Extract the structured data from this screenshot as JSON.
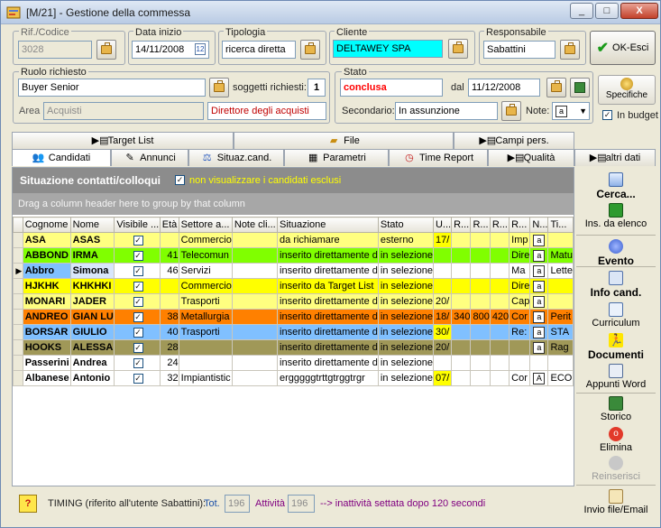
{
  "window": {
    "title": "[M/21] - Gestione della commessa",
    "controls": {
      "minimize": "_",
      "maximize": "□",
      "close": "X"
    }
  },
  "header": {
    "rif_label": "Rif./Codice",
    "rif_value": "3028",
    "data_inizio_label": "Data inizio",
    "data_inizio_value": "14/11/2008",
    "tipologia_label": "Tipologia",
    "tipologia_value": "ricerca diretta",
    "cliente_label": "Cliente",
    "cliente_value": "DELTAWEY SPA",
    "responsabile_label": "Responsabile",
    "responsabile_value": "Sabattini",
    "ok_label": "OK-Esci",
    "ruolo_label": "Ruolo richiesto",
    "ruolo_value": "Buyer Senior",
    "soggetti_label": "soggetti richiesti:",
    "soggetti_value": "1",
    "area_label": "Area",
    "area_value": "Acquisti",
    "direttore_value": "Direttore degli acquisti",
    "stato_label": "Stato",
    "stato_value": "conclusa",
    "dal_label": "dal",
    "dal_value": "11/12/2008",
    "secondario_label": "Secondario:",
    "secondario_value": "In assunzione",
    "note_label": "Note:",
    "specifiche_label": "Specifiche",
    "in_budget_label": "In budget",
    "in_budget_checked": "✓"
  },
  "tabs_top": [
    {
      "label": "Target List",
      "icon": "target-list-icon"
    },
    {
      "label": "File",
      "icon": "folder-icon"
    },
    {
      "label": "Campi pers.",
      "icon": "custom-fields-icon"
    }
  ],
  "tabs_bottom": [
    {
      "label": "Candidati",
      "icon": "people-icon"
    },
    {
      "label": "Annunci",
      "icon": "ads-icon"
    },
    {
      "label": "Situaz.cand.",
      "icon": "status-icon"
    },
    {
      "label": "Parametri",
      "icon": "params-icon"
    },
    {
      "label": "Time Report",
      "icon": "clock-icon"
    },
    {
      "label": "Qualità",
      "icon": "quality-icon"
    },
    {
      "label": "altri dati",
      "icon": "other-data-icon"
    }
  ],
  "section": {
    "title": "Situazione contatti/colloqui",
    "filter_label": "non visualizzare i candidati esclusi",
    "filter_checked": "✓",
    "group_hint": "Drag a column header here to group by that column"
  },
  "grid": {
    "columns": [
      "Cognome",
      "Nome",
      "Visibile ...",
      "Età",
      "Settore a...",
      "Note cli...",
      "Situazione",
      "Stato",
      "U...",
      "R...",
      "R...",
      "R...",
      "R...",
      "N...",
      "Ti..."
    ],
    "rows": [
      {
        "bg": "#ffff80",
        "cells": [
          "ASA",
          "ASAS",
          "✓",
          "",
          "Commercio",
          "",
          "da richiamare",
          "esterno",
          "17/",
          "",
          "",
          "",
          "Imp",
          "a",
          ""
        ],
        "bold": true
      },
      {
        "bg": "#80ff00",
        "cells": [
          "ABBOND",
          "IRMA",
          "✓",
          "41",
          "Telecomun",
          "",
          "inserito direttamente d",
          "in selezione",
          "",
          "",
          "",
          "",
          "Dire",
          "a",
          "Matu"
        ],
        "bold": true
      },
      {
        "bg": "#ffffff",
        "cells": [
          "Abbro",
          "Simona",
          "✓",
          "46",
          "Servizi",
          "",
          "inserito direttamente d",
          "in selezione",
          "",
          "",
          "",
          "",
          "Ma",
          "a",
          "Lette"
        ],
        "bold": true,
        "current": true
      },
      {
        "bg": "#ffff00",
        "cells": [
          "HJKHK",
          "KHKHKI",
          "✓",
          "",
          "Commercio",
          "",
          "inserito da Target List",
          "in selezione",
          "",
          "",
          "",
          "",
          "Dire",
          "a",
          ""
        ],
        "bold": true
      },
      {
        "bg": "#ffff80",
        "cells": [
          "MONARI",
          "JADER",
          "✓",
          "",
          "Trasporti",
          "",
          "inserito direttamente d",
          "in selezione",
          "20/",
          "",
          "",
          "",
          "Cap",
          "a",
          ""
        ],
        "bold": true
      },
      {
        "bg": "#ff8000",
        "cells": [
          "ANDREO",
          "GIAN LU",
          "✓",
          "38",
          "Metallurgia",
          "",
          "inserito direttamente d",
          "in selezione",
          "18/",
          "340",
          "800",
          "420",
          "Cor",
          "a",
          "Perit"
        ],
        "bold": true
      },
      {
        "bg": "#80c0ff",
        "cells": [
          "BORSAR",
          "GIULIO",
          "✓",
          "40",
          "Trasporti",
          "",
          "inserito direttamente d",
          "in selezione",
          "30/",
          "",
          "",
          "",
          "Re:",
          "a",
          "STA"
        ],
        "bold": true
      },
      {
        "bg": "#a09858",
        "cells": [
          "HOOKS",
          "ALESSA",
          "✓",
          "28",
          "",
          "",
          "inserito direttamente d",
          "in selezione",
          "20/",
          "",
          "",
          "",
          "",
          "a",
          "Rag"
        ],
        "bold": true
      },
      {
        "bg": "#ffffff",
        "cells": [
          "Passerini",
          "Andrea",
          "✓",
          "24",
          "",
          "",
          "inserito direttamente d",
          "in selezione",
          "",
          "",
          "",
          "",
          "",
          "",
          ""
        ],
        "bold": true
      },
      {
        "bg": "#ffffff",
        "cells": [
          "Albanese",
          "Antonio",
          "✓",
          "32",
          "Impiantistic",
          "",
          "ergggggtrttgtrggtrgr",
          "in selezione",
          "07/",
          "",
          "",
          "",
          "Cor",
          "A",
          "ECO"
        ],
        "bold": true
      }
    ]
  },
  "sidebar": [
    {
      "label": "Cerca...",
      "icon": "search-icon",
      "bold": true
    },
    {
      "label": "Ins. da elenco",
      "icon": "insert-list-icon",
      "bold": false
    },
    {
      "label": "Evento",
      "icon": "event-icon",
      "bold": true
    },
    {
      "label": "Info cand.",
      "icon": "info-card-icon",
      "bold": true
    },
    {
      "label": "Curriculum",
      "icon": "document-icon",
      "bold": false
    },
    {
      "label": "Documenti",
      "icon": "running-man-icon",
      "bold": true
    },
    {
      "label": "Appunti Word",
      "icon": "word-notes-icon",
      "bold": false
    },
    {
      "label": "Storico",
      "icon": "history-icon",
      "bold": false
    },
    {
      "label": "Elimina",
      "icon": "delete-icon",
      "bold": false
    },
    {
      "label": "Reinserisci",
      "icon": "reinsert-icon",
      "bold": false,
      "disabled": true
    },
    {
      "label": "Invio file/Email",
      "icon": "email-icon",
      "bold": false
    }
  ],
  "footer": {
    "help": "?",
    "timing_label": "TIMING (riferito all'utente Sabattini):",
    "tot_label": "Tot.",
    "tot_value": "196",
    "attivita_label": "Attività",
    "attivita_value": "196",
    "inattivita_note": "--> inattività settata dopo 120 secondi"
  },
  "colors": {
    "title_bar": "#c8d6ea",
    "cliente_bg": "#00ffff",
    "stato_text": "#ff0000",
    "direttore_text": "#c00000",
    "filter_text": "#ffff00",
    "footer_purple": "#800080"
  }
}
